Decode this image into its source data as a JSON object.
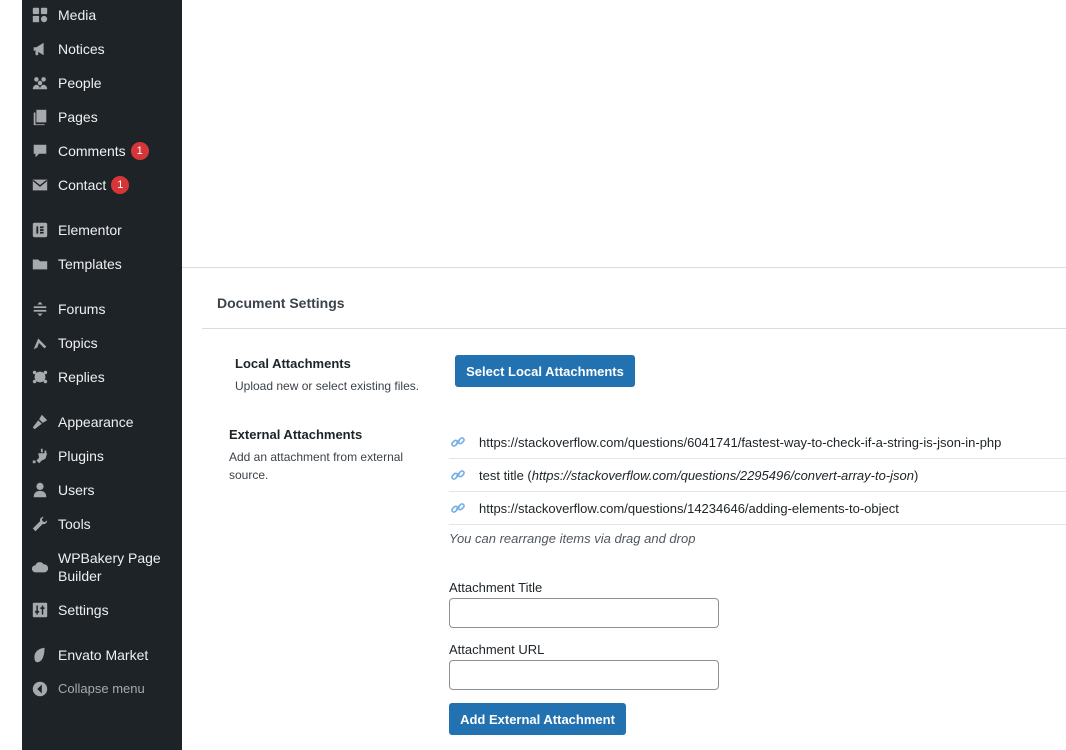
{
  "sidebar": {
    "items": [
      {
        "label": "Media",
        "icon": "media-icon"
      },
      {
        "label": "Notices",
        "icon": "megaphone-icon"
      },
      {
        "label": "People",
        "icon": "people-icon"
      },
      {
        "label": "Pages",
        "icon": "pages-icon"
      },
      {
        "label": "Comments",
        "icon": "comments-icon",
        "badge": "1"
      },
      {
        "label": "Contact",
        "icon": "mail-icon",
        "badge": "1"
      },
      {
        "label": "Elementor",
        "icon": "elementor-icon"
      },
      {
        "label": "Templates",
        "icon": "folder-icon"
      },
      {
        "label": "Forums",
        "icon": "forums-icon"
      },
      {
        "label": "Topics",
        "icon": "topics-icon"
      },
      {
        "label": "Replies",
        "icon": "replies-icon"
      },
      {
        "label": "Appearance",
        "icon": "brush-icon"
      },
      {
        "label": "Plugins",
        "icon": "plugin-icon"
      },
      {
        "label": "Users",
        "icon": "user-icon"
      },
      {
        "label": "Tools",
        "icon": "wrench-icon"
      },
      {
        "label": "WPBakery Page Builder",
        "icon": "cloud-icon"
      },
      {
        "label": "Settings",
        "icon": "settings-icon"
      },
      {
        "label": "Envato Market",
        "icon": "leaf-icon"
      }
    ],
    "collapse_label": "Collapse menu"
  },
  "panel": {
    "title": "Document Settings"
  },
  "local_attachments": {
    "label": "Local Attachments",
    "description": "Upload new or select existing files.",
    "button_label": "Select Local Attachments"
  },
  "external_attachments": {
    "label": "External Attachments",
    "description": "Add an attachment from external source.",
    "items": [
      {
        "title": "",
        "url": "https://stackoverflow.com/questions/6041741/fastest-way-to-check-if-a-string-is-json-in-php"
      },
      {
        "title": "test title",
        "url": "https://stackoverflow.com/questions/2295496/convert-array-to-json"
      },
      {
        "title": "",
        "url": "https://stackoverflow.com/questions/14234646/adding-elements-to-object"
      }
    ],
    "hint": "You can rearrange items via drag and drop",
    "title_field_label": "Attachment Title",
    "title_field_value": "",
    "url_field_label": "Attachment URL",
    "url_field_value": "",
    "add_button_label": "Add External Attachment"
  },
  "colors": {
    "sidebar_bg": "#1d2327",
    "primary_button": "#2271b1",
    "badge": "#d63638",
    "link_icon": "#72aee6"
  }
}
